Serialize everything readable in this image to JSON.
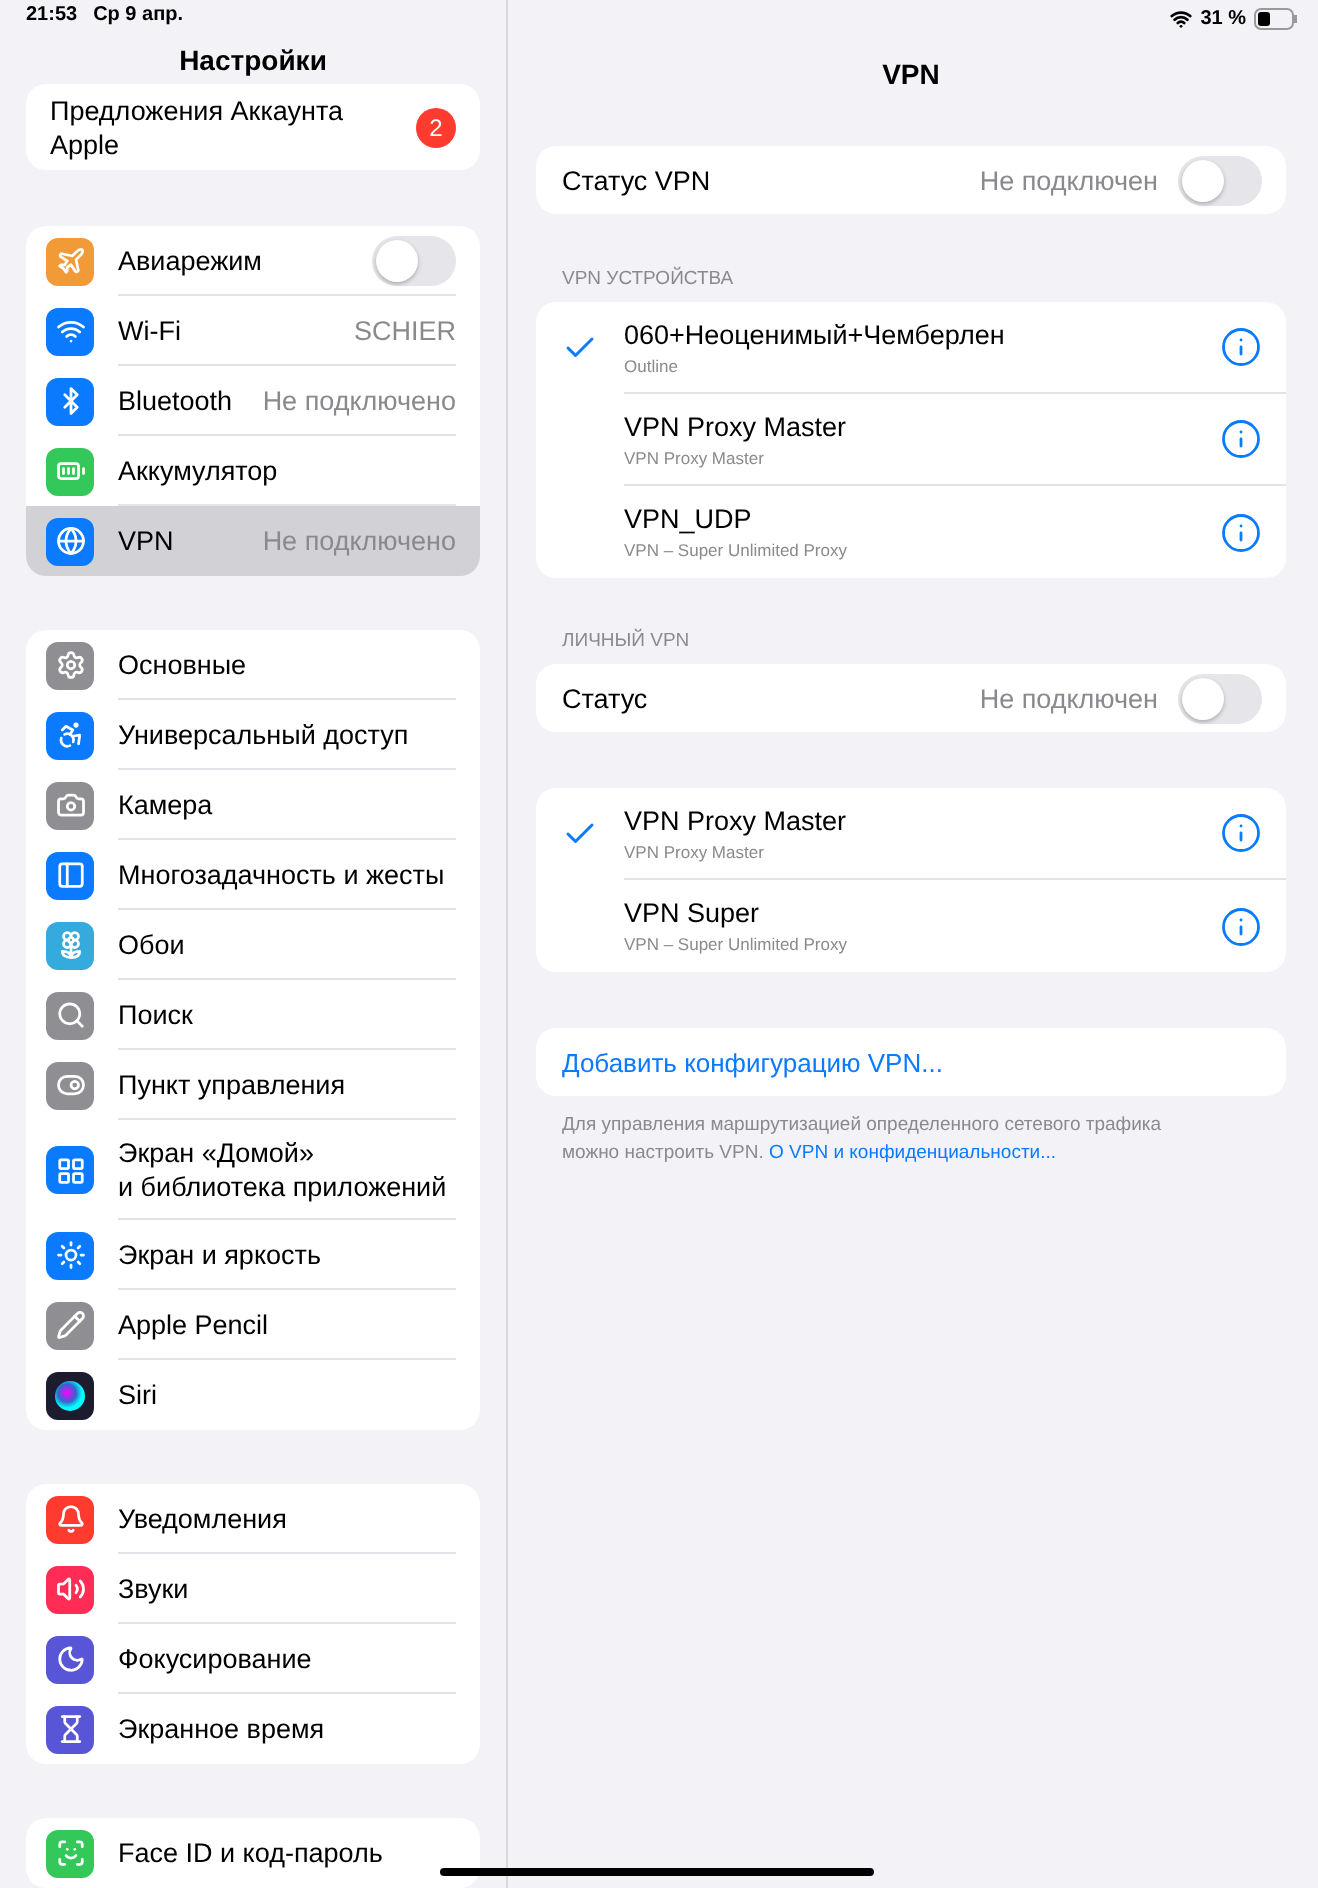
{
  "status_bar": {
    "time": "21:53",
    "date": "Ср 9 апр.",
    "battery": "31 %"
  },
  "sidebar": {
    "title": "Настройки",
    "account": {
      "label": "Предложения Аккаунта\nApple",
      "badge": "2"
    },
    "groups": [
      {
        "items": [
          {
            "label": "Авиарежим",
            "toggle": {
              "on": false
            },
            "selected": false,
            "color": "#f19a37"
          },
          {
            "label": "Wi-Fi",
            "value": "SCHIER",
            "selected": false,
            "color": "#0a7aff"
          },
          {
            "label": "Bluetooth",
            "value": "Не подключено",
            "selected": false,
            "color": "#0a7aff"
          },
          {
            "label": "Аккумулятор",
            "selected": false,
            "color": "#34c759"
          },
          {
            "label": "VPN",
            "value": "Не подключено",
            "selected": true,
            "color": "#0a7aff"
          }
        ]
      },
      {
        "items": [
          {
            "label": "Основные",
            "selected": false,
            "color": "#8e8e93"
          },
          {
            "label": "Универсальный доступ",
            "selected": false,
            "color": "#0a7aff"
          },
          {
            "label": "Камера",
            "selected": false,
            "color": "#8e8e93"
          },
          {
            "label": "Многозадачность и жесты",
            "selected": false,
            "color": "#0a7aff"
          },
          {
            "label": "Обои",
            "selected": false,
            "color": "#35aadc"
          },
          {
            "label": "Поиск",
            "selected": false,
            "color": "#8e8e93"
          },
          {
            "label": "Пункт управления",
            "selected": false,
            "color": "#8e8e93"
          },
          {
            "label": "Экран «Домой»\nи библиотека приложений",
            "selected": false,
            "color": "#0a7aff"
          },
          {
            "label": "Экран и яркость",
            "selected": false,
            "color": "#0a7aff"
          },
          {
            "label": "Apple Pencil",
            "selected": false,
            "color": "#8e8e93"
          },
          {
            "label": "Siri",
            "selected": false,
            "color": "#1c1c2e"
          }
        ]
      },
      {
        "items": [
          {
            "label": "Уведомления",
            "selected": false,
            "color": "#ff3b30"
          },
          {
            "label": "Звуки",
            "selected": false,
            "color": "#ff2d55"
          },
          {
            "label": "Фокусирование",
            "selected": false,
            "color": "#5856d6"
          },
          {
            "label": "Экранное время",
            "selected": false,
            "color": "#5856d6"
          }
        ]
      },
      {
        "items": [
          {
            "label": "Face ID и код-пароль",
            "selected": false,
            "color": "#34c759"
          }
        ]
      }
    ]
  },
  "detail": {
    "title": "VPN",
    "status": {
      "label": "Статус VPN",
      "value": "Не подключен",
      "toggle": {
        "on": false
      }
    },
    "devices": {
      "header": "VPN УСТРОЙСТВА",
      "items": [
        {
          "name": "060+Неоценимый+Чемберлен",
          "subtitle": "Outline",
          "selected": true
        },
        {
          "name": "VPN Proxy Master",
          "subtitle": "VPN Proxy Master",
          "selected": false
        },
        {
          "name": "VPN_UDP",
          "subtitle": "VPN – Super Unlimited Proxy",
          "selected": false
        }
      ]
    },
    "personal": {
      "header": "ЛИЧНЫЙ VPN",
      "status": {
        "label": "Статус",
        "value": "Не подключен",
        "toggle": {
          "on": false
        }
      },
      "items": [
        {
          "name": "VPN Proxy Master",
          "subtitle": "VPN Proxy Master",
          "selected": true
        },
        {
          "name": "VPN Super",
          "subtitle": "VPN – Super Unlimited Proxy",
          "selected": false
        }
      ]
    },
    "add_link": "Добавить конфигурацию VPN...",
    "footer": {
      "text": "Для управления маршрутизацией определенного сетевого трафика можно настроить VPN.",
      "link": "О VPN и конфиденциальности..."
    }
  }
}
